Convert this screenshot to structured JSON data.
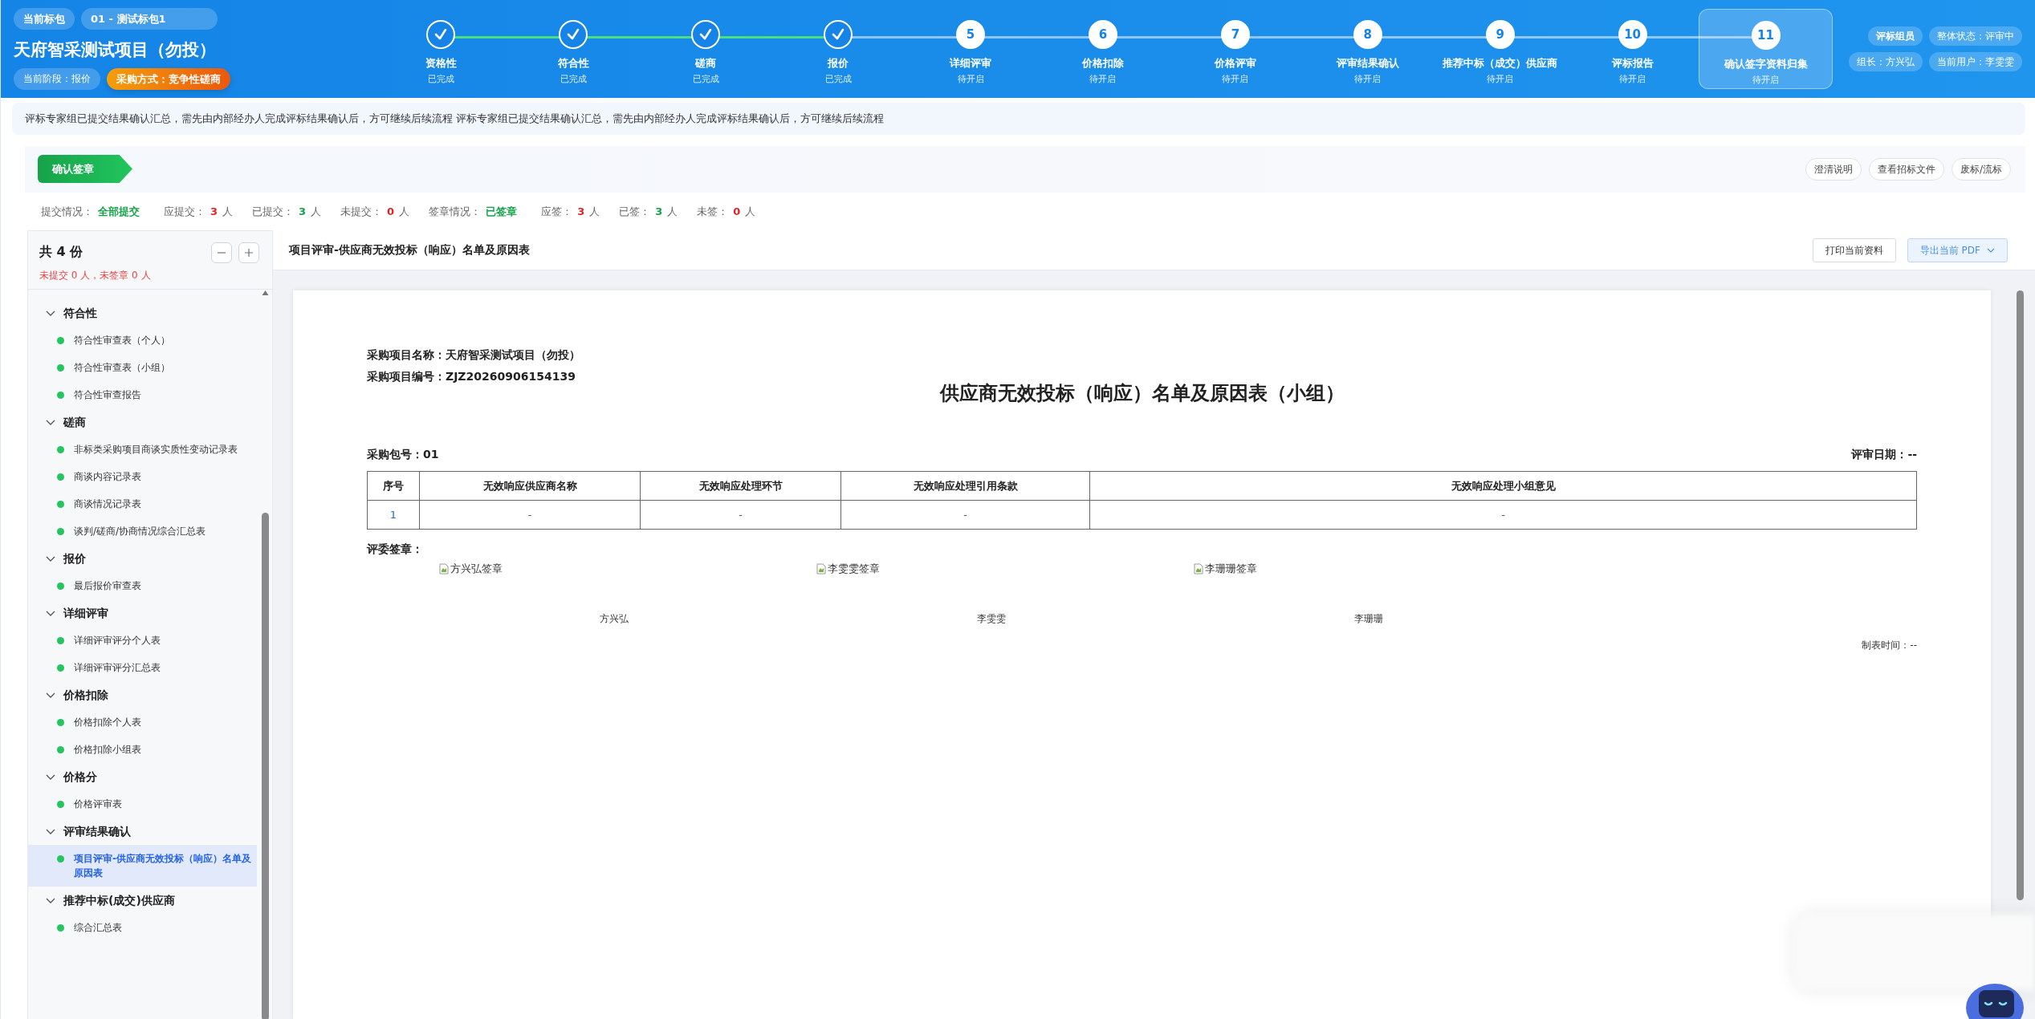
{
  "header": {
    "package_label": "当前标包",
    "package_value": "01 - 测试标包1",
    "project_title": "天府智采测试项目（勿投）",
    "stage": "当前阶段：报价",
    "method": "采购方式：竞争性磋商",
    "steps": [
      {
        "label": "资格性",
        "status": "已完成",
        "done": true,
        "selected": false
      },
      {
        "label": "符合性",
        "status": "已完成",
        "done": true,
        "selected": false
      },
      {
        "label": "磋商",
        "status": "已完成",
        "done": true,
        "selected": false
      },
      {
        "label": "报价",
        "status": "已完成",
        "done": true,
        "selected": false
      },
      {
        "number": "5",
        "label": "详细评审",
        "status": "待开启",
        "done": false,
        "selected": false
      },
      {
        "number": "6",
        "label": "价格扣除",
        "status": "待开启",
        "done": false,
        "selected": false
      },
      {
        "number": "7",
        "label": "价格评审",
        "status": "待开启",
        "done": false,
        "selected": false
      },
      {
        "number": "8",
        "label": "评审结果确认",
        "status": "待开启",
        "done": false,
        "selected": false
      },
      {
        "number": "9",
        "label": "推荐中标（成交）供应商",
        "status": "待开启",
        "done": false,
        "selected": false
      },
      {
        "number": "10",
        "label": "评标报告",
        "status": "待开启",
        "done": false,
        "selected": false
      },
      {
        "number": "11",
        "label": "确认签字资料归集",
        "status": "待开启",
        "done": false,
        "selected": true
      }
    ],
    "badges": [
      "评标组员",
      "整体状态：评审中",
      "组长：方兴弘",
      "当前用户：李雯雯"
    ]
  },
  "notice": "评标专家组已提交结果确认汇总，需先由内部经办人完成评标结果确认后，方可继续后续流程 评标专家组已提交结果确认汇总，需先由内部经办人完成评标结果确认后，方可继续后续流程",
  "sign_bar": {
    "stage_tag": "确认签章",
    "buttons": [
      "澄清说明",
      "查看招标文件",
      "废标/流标"
    ]
  },
  "stats": [
    {
      "label": "提交情况：",
      "value": "全部提交",
      "color": "#16a34a"
    },
    {
      "label": "应提交：",
      "value": "3",
      "unit": "人",
      "color": "#dc2626"
    },
    {
      "label": "已提交：",
      "value": "3",
      "unit": "人",
      "color": "#16a34a"
    },
    {
      "label": "未提交：",
      "value": "0",
      "unit": "人",
      "color": "#dc2626"
    },
    {
      "label": "签章情况：",
      "value": "已签章",
      "color": "#16a34a"
    },
    {
      "label": "应签：",
      "value": "3",
      "unit": "人",
      "color": "#dc2626"
    },
    {
      "label": "已签：",
      "value": "3",
      "unit": "人",
      "color": "#16a34a"
    },
    {
      "label": "未签：",
      "value": "0",
      "unit": "人",
      "color": "#dc2626"
    }
  ],
  "sidebar": {
    "total": "共 4 份",
    "summary": "未提交 0 人，未签章 0 人",
    "groups": [
      {
        "title": "符合性",
        "expanded": true,
        "children": [
          {
            "label": "符合性审查表（个人）",
            "selected": false
          },
          {
            "label": "符合性审查表（小组）",
            "selected": false
          },
          {
            "label": "符合性审查报告",
            "selected": false
          }
        ]
      },
      {
        "title": "磋商",
        "expanded": true,
        "children": [
          {
            "label": "非标类采购项目商谈实质性变动记录表",
            "selected": false
          },
          {
            "label": "商谈内容记录表",
            "selected": false
          },
          {
            "label": "商谈情况记录表",
            "selected": false
          },
          {
            "label": "谈判/磋商/协商情况综合汇总表",
            "selected": false
          }
        ]
      },
      {
        "title": "报价",
        "expanded": true,
        "children": [
          {
            "label": "最后报价审查表",
            "selected": false
          }
        ]
      },
      {
        "title": "详细评审",
        "expanded": true,
        "children": [
          {
            "label": "详细评审评分个人表",
            "selected": false
          },
          {
            "label": "详细评审评分汇总表",
            "selected": false
          }
        ]
      },
      {
        "title": "价格扣除",
        "expanded": true,
        "children": [
          {
            "label": "价格扣除个人表",
            "selected": false
          },
          {
            "label": "价格扣除小组表",
            "selected": false
          }
        ]
      },
      {
        "title": "价格分",
        "expanded": true,
        "children": [
          {
            "label": "价格评审表",
            "selected": false
          }
        ]
      },
      {
        "title": "评审结果确认",
        "expanded": true,
        "children": [
          {
            "label": "项目评审-供应商无效投标（响应）名单及原因表",
            "selected": true
          }
        ]
      },
      {
        "title": "推荐中标(成交)供应商",
        "expanded": true,
        "children": [
          {
            "label": "综合汇总表",
            "selected": false
          }
        ]
      }
    ]
  },
  "document": {
    "title": "项目评审-供应商无效投标（响应）名单及原因表",
    "actions": [
      {
        "label": "打印当前资料",
        "kind": "plain"
      },
      {
        "label": "导出当前 PDF",
        "kind": "dropdown"
      }
    ],
    "paper": {
      "fields": [
        "采购项目名称：天府智采测试项目（勿投）",
        "采购项目编号：ZJZ20260906154139"
      ],
      "heading": "供应商无效投标（响应）名单及原因表（小组）",
      "package": "采购包号：01",
      "review_date": "评审日期：--",
      "table": {
        "columns": [
          "序号",
          "无效响应供应商名称",
          "无效响应处理环节",
          "无效响应处理引用条款",
          "无效响应处理小组意见"
        ],
        "rows": [
          [
            "1",
            "-",
            "-",
            "-",
            "-"
          ]
        ]
      },
      "sign_label": "评委签章：",
      "signers": [
        {
          "image_alt": "方兴弘签章",
          "name": "方兴弘"
        },
        {
          "image_alt": "李雯雯签章",
          "name": "李雯雯"
        },
        {
          "image_alt": "李珊珊签章",
          "name": "李珊珊"
        }
      ],
      "made_time": "制表时间：--"
    }
  }
}
